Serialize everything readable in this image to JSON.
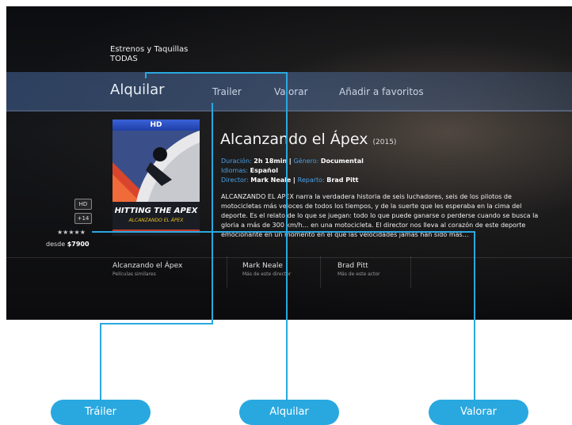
{
  "header": {
    "section_title": "Estrenos y Taquillas",
    "section_filter": "TODAS"
  },
  "tabs": [
    {
      "label": "Alquilar"
    },
    {
      "label": "Trailer"
    },
    {
      "label": "Valorar"
    },
    {
      "label": "Añadir a favoritos"
    }
  ],
  "poster": {
    "quality_badge": "HD",
    "title": "HITTING THE APEX",
    "subtitle": "ALCANZANDO EL ÁPEX"
  },
  "badges": [
    "HD",
    "+14"
  ],
  "rating_stars": "★★★★★",
  "price": {
    "prefix": "desde",
    "amount": "$7900"
  },
  "movie": {
    "title": "Alcanzando el Ápex",
    "year": "(2015)",
    "duration_label": "Duración:",
    "duration": "2h 18min",
    "genre_label": "Género:",
    "genre": "Documental",
    "languages_label": "Idiomas:",
    "languages": "Español",
    "director_label": "Director:",
    "director": "Mark Neale",
    "cast_label": "Reparto:",
    "cast": "Brad Pitt",
    "synopsis": "ALCANZANDO EL APEX narra la verdadera historia de seis luchadores, seis de los pilotos de motocicletas más veloces de todos los tiempos, y de la suerte que les esperaba en la cima del deporte. Es el relato de lo que se juegan: todo lo que puede ganarse o perderse cuando se busca la gloria a más de 300 km/h… en una motocicleta. El director nos lleva al corazón de este deporte emocionante en un momento en el que las velocidades jamás han sido más…"
  },
  "related": [
    {
      "title": "Alcanzando el Ápex",
      "subtitle": "Películas similares"
    },
    {
      "title": "Mark Neale",
      "subtitle": "Más de este director"
    },
    {
      "title": "Brad Pitt",
      "subtitle": "Más de este actor"
    }
  ],
  "callouts": [
    {
      "label": "Tráiler"
    },
    {
      "label": "Alquilar"
    },
    {
      "label": "Valorar"
    }
  ],
  "colors": {
    "callout": "#29a8e0",
    "metadata_key": "#4aa0e6",
    "nav_band": "#46608a"
  }
}
